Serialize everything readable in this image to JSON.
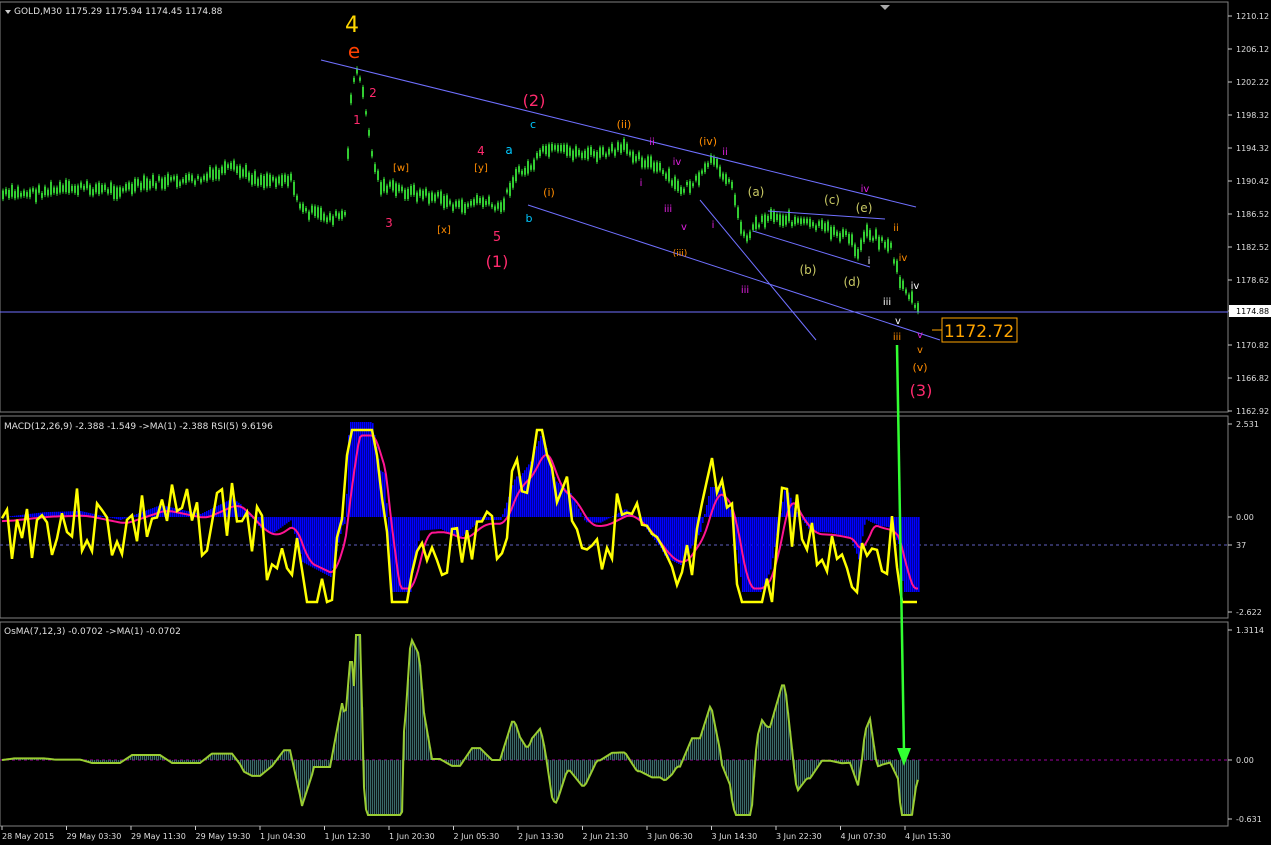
{
  "main": {
    "symbol_line": "GOLD,M30  1175.29 1175.94 1174.45 1174.88",
    "price_ticks": [
      "1210.12",
      "1206.12",
      "1202.22",
      "1198.32",
      "1194.32",
      "1190.42",
      "1186.52",
      "1182.52",
      "1178.62",
      "1174.88",
      "1170.82",
      "1166.82",
      "1162.92"
    ],
    "current_price": "1174.88",
    "target_label": "1172.72"
  },
  "macd": {
    "header": "MACD(12,26,9) -2.388 -1.549  ->MA(1) -2.388  RSI(5) 9.6196",
    "ticks": [
      "2.531",
      "0.00",
      "37",
      "-2.622"
    ]
  },
  "osma": {
    "header": "OsMA(7,12,3) -0.0702  ->MA(1) -0.0702",
    "ticks": [
      "1.3114",
      "0.00",
      "-0.631"
    ]
  },
  "time_axis": [
    "28 May 2015",
    "29 May 03:30",
    "29 May 11:30",
    "29 May 19:30",
    "1 Jun 04:30",
    "1 Jun 12:30",
    "1 Jun 20:30",
    "2 Jun 05:30",
    "2 Jun 13:30",
    "2 Jun 21:30",
    "3 Jun 06:30",
    "3 Jun 14:30",
    "3 Jun 22:30",
    "4 Jun 07:30",
    "4 Jun 15:30"
  ],
  "wave_labels": [
    {
      "t": "4",
      "c": "#ffd700"
    },
    {
      "t": "e",
      "c": "#ff4000"
    },
    {
      "t": "1",
      "c": "#ff2a6d"
    },
    {
      "t": "2",
      "c": "#ff2a6d"
    },
    {
      "t": "3",
      "c": "#ff2a6d"
    },
    {
      "t": "[w]",
      "c": "#ff8c00"
    },
    {
      "t": "[x]",
      "c": "#ff8c00"
    },
    {
      "t": "[y]",
      "c": "#ff8c00"
    },
    {
      "t": "4",
      "c": "#ff2a6d"
    },
    {
      "t": "5",
      "c": "#ff2a6d"
    },
    {
      "t": "(1)",
      "c": "#ff2a6d"
    },
    {
      "t": "a",
      "c": "#00c8ff"
    },
    {
      "t": "b",
      "c": "#00c8ff"
    },
    {
      "t": "c",
      "c": "#00c8ff"
    },
    {
      "t": "(2)",
      "c": "#ff2a6d"
    },
    {
      "t": "(i)",
      "c": "#ff8c00"
    },
    {
      "t": "(ii)",
      "c": "#ff8c00"
    },
    {
      "t": "(iii)",
      "c": "#ff8c00"
    },
    {
      "t": "(iv)",
      "c": "#ff8c00"
    },
    {
      "t": "i",
      "c": "#e020e0"
    },
    {
      "t": "ii",
      "c": "#e020e0"
    },
    {
      "t": "iii",
      "c": "#e020e0"
    },
    {
      "t": "iv",
      "c": "#e020e0"
    },
    {
      "t": "v",
      "c": "#e020e0"
    },
    {
      "t": "i",
      "c": "#e020e0"
    },
    {
      "t": "ii",
      "c": "#e020e0"
    },
    {
      "t": "iii",
      "c": "#e020e0"
    },
    {
      "t": "(a)",
      "c": "#c8c864"
    },
    {
      "t": "(b)",
      "c": "#c8c864"
    },
    {
      "t": "(c)",
      "c": "#c8c864"
    },
    {
      "t": "(d)",
      "c": "#c8c864"
    },
    {
      "t": "(e)",
      "c": "#c8c864"
    },
    {
      "t": "iv",
      "c": "#e020e0"
    },
    {
      "t": "i",
      "c": "#ffffff"
    },
    {
      "t": "ii",
      "c": "#ff8c00"
    },
    {
      "t": "iii",
      "c": "#ffffff"
    },
    {
      "t": "iv",
      "c": "#ff8c00"
    },
    {
      "t": "iv",
      "c": "#ffffff"
    },
    {
      "t": "v",
      "c": "#ffffff"
    },
    {
      "t": "iii",
      "c": "#ff8c00"
    },
    {
      "t": "v",
      "c": "#e020e0"
    },
    {
      "t": "v",
      "c": "#ff8c00"
    },
    {
      "t": "(v)",
      "c": "#ff8c00"
    },
    {
      "t": "(3)",
      "c": "#ff2a6d"
    }
  ],
  "colors": {
    "background": "#000000",
    "candles": "#32cd32",
    "channel_lines": "#7070ff",
    "macd_histogram": "#0000ff",
    "macd_signal": "#ff1493",
    "rsi": "#ffff00",
    "osma_line": "#9acd32",
    "arrow": "#32ff32",
    "target_box": "#ffa500",
    "grid_separator": "#808080"
  }
}
